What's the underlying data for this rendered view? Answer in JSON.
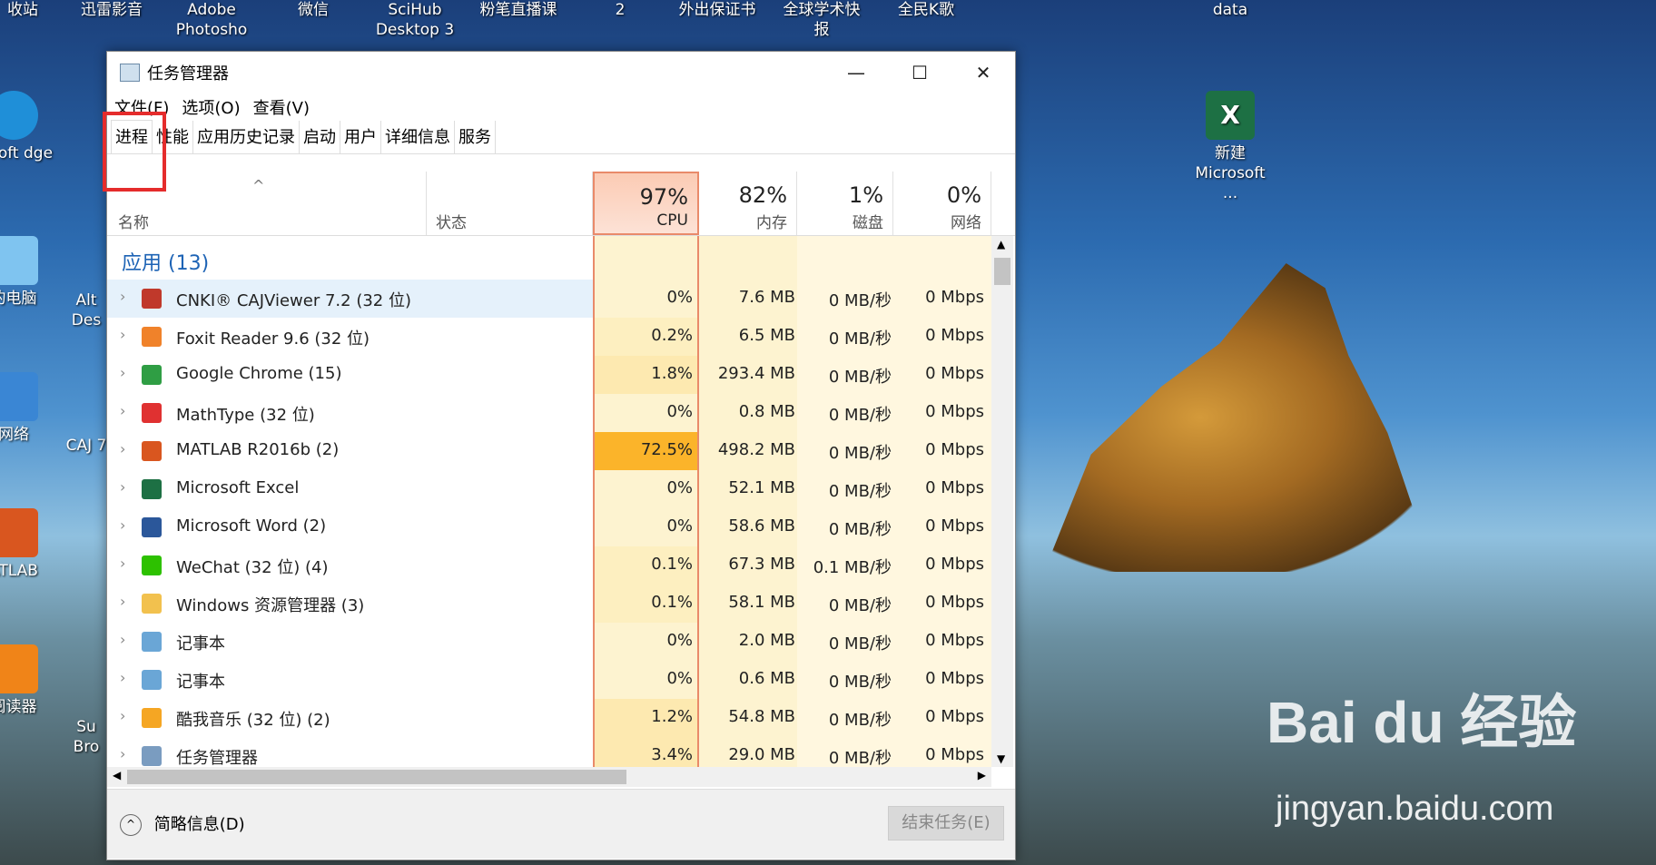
{
  "desktop": {
    "icons": [
      {
        "label": "收站"
      },
      {
        "label": "迅雷影音"
      },
      {
        "label": "Adobe Photosho"
      },
      {
        "label": "微信"
      },
      {
        "label": "SciHub Desktop 3"
      },
      {
        "label": "粉笔直播课"
      },
      {
        "label": "2"
      },
      {
        "label": "外出保证书"
      },
      {
        "label": "全球学术快报"
      },
      {
        "label": "全民K歌"
      },
      {
        "label": "data"
      },
      {
        "label": "新建 Microsoft ..."
      },
      {
        "label": "rosoft dge"
      },
      {
        "label": "的电脑"
      },
      {
        "label": "网络"
      },
      {
        "label": "ATLAB"
      },
      {
        "label": "阅读器"
      },
      {
        "label": "Alt Des"
      },
      {
        "label": "CAJ 7"
      },
      {
        "label": "Su Bro"
      }
    ],
    "watermark": "Bai du 经验",
    "watermark_sub": "jingyan.baidu.com"
  },
  "window": {
    "title": "任务管理器",
    "minimize": "—",
    "maximize": "☐",
    "close": "✕",
    "menu": [
      "文件(F)",
      "选项(O)",
      "查看(V)"
    ],
    "tabs": [
      "进程",
      "性能",
      "应用历史记录",
      "启动",
      "用户",
      "详细信息",
      "服务"
    ],
    "active_tab": "进程",
    "header": {
      "name": "名称",
      "status": "状态",
      "cpu_pct": "97%",
      "cpu": "CPU",
      "mem_pct": "82%",
      "mem": "内存",
      "disk_pct": "1%",
      "disk": "磁盘",
      "net_pct": "0%",
      "net": "网络"
    },
    "group_title": "应用 (13)",
    "rows": [
      {
        "name": "CNKI® CAJViewer 7.2 (32 位)",
        "cpu": "0%",
        "mem": "7.6 MB",
        "disk": "0 MB/秒",
        "net": "0 Mbps",
        "icon": "cajviewer-icon"
      },
      {
        "name": "Foxit Reader 9.6 (32 位)",
        "cpu": "0.2%",
        "mem": "6.5 MB",
        "disk": "0 MB/秒",
        "net": "0 Mbps",
        "icon": "foxit-icon"
      },
      {
        "name": "Google Chrome (15)",
        "cpu": "1.8%",
        "mem": "293.4 MB",
        "disk": "0 MB/秒",
        "net": "0 Mbps",
        "icon": "chrome-icon"
      },
      {
        "name": "MathType (32 位)",
        "cpu": "0%",
        "mem": "0.8 MB",
        "disk": "0 MB/秒",
        "net": "0 Mbps",
        "icon": "mathtype-icon"
      },
      {
        "name": "MATLAB R2016b (2)",
        "cpu": "72.5%",
        "mem": "498.2 MB",
        "disk": "0 MB/秒",
        "net": "0 Mbps",
        "icon": "matlab-icon"
      },
      {
        "name": "Microsoft Excel",
        "cpu": "0%",
        "mem": "52.1 MB",
        "disk": "0 MB/秒",
        "net": "0 Mbps",
        "icon": "excel-icon"
      },
      {
        "name": "Microsoft Word (2)",
        "cpu": "0%",
        "mem": "58.6 MB",
        "disk": "0 MB/秒",
        "net": "0 Mbps",
        "icon": "word-icon"
      },
      {
        "name": "WeChat (32 位) (4)",
        "cpu": "0.1%",
        "mem": "67.3 MB",
        "disk": "0.1 MB/秒",
        "net": "0 Mbps",
        "icon": "wechat-icon"
      },
      {
        "name": "Windows 资源管理器 (3)",
        "cpu": "0.1%",
        "mem": "58.1 MB",
        "disk": "0 MB/秒",
        "net": "0 Mbps",
        "icon": "folder-icon"
      },
      {
        "name": "记事本",
        "cpu": "0%",
        "mem": "2.0 MB",
        "disk": "0 MB/秒",
        "net": "0 Mbps",
        "icon": "notepad-icon"
      },
      {
        "name": "记事本",
        "cpu": "0%",
        "mem": "0.6 MB",
        "disk": "0 MB/秒",
        "net": "0 Mbps",
        "icon": "notepad-icon"
      },
      {
        "name": "酷我音乐 (32 位) (2)",
        "cpu": "1.2%",
        "mem": "54.8 MB",
        "disk": "0 MB/秒",
        "net": "0 Mbps",
        "icon": "kuwo-icon"
      },
      {
        "name": "任务管理器",
        "cpu": "3.4%",
        "mem": "29.0 MB",
        "disk": "0 MB/秒",
        "net": "0 Mbps",
        "icon": "taskmgr-icon"
      }
    ],
    "footer": {
      "less_details": "简略信息(D)",
      "end_task": "结束任务(E)"
    }
  }
}
